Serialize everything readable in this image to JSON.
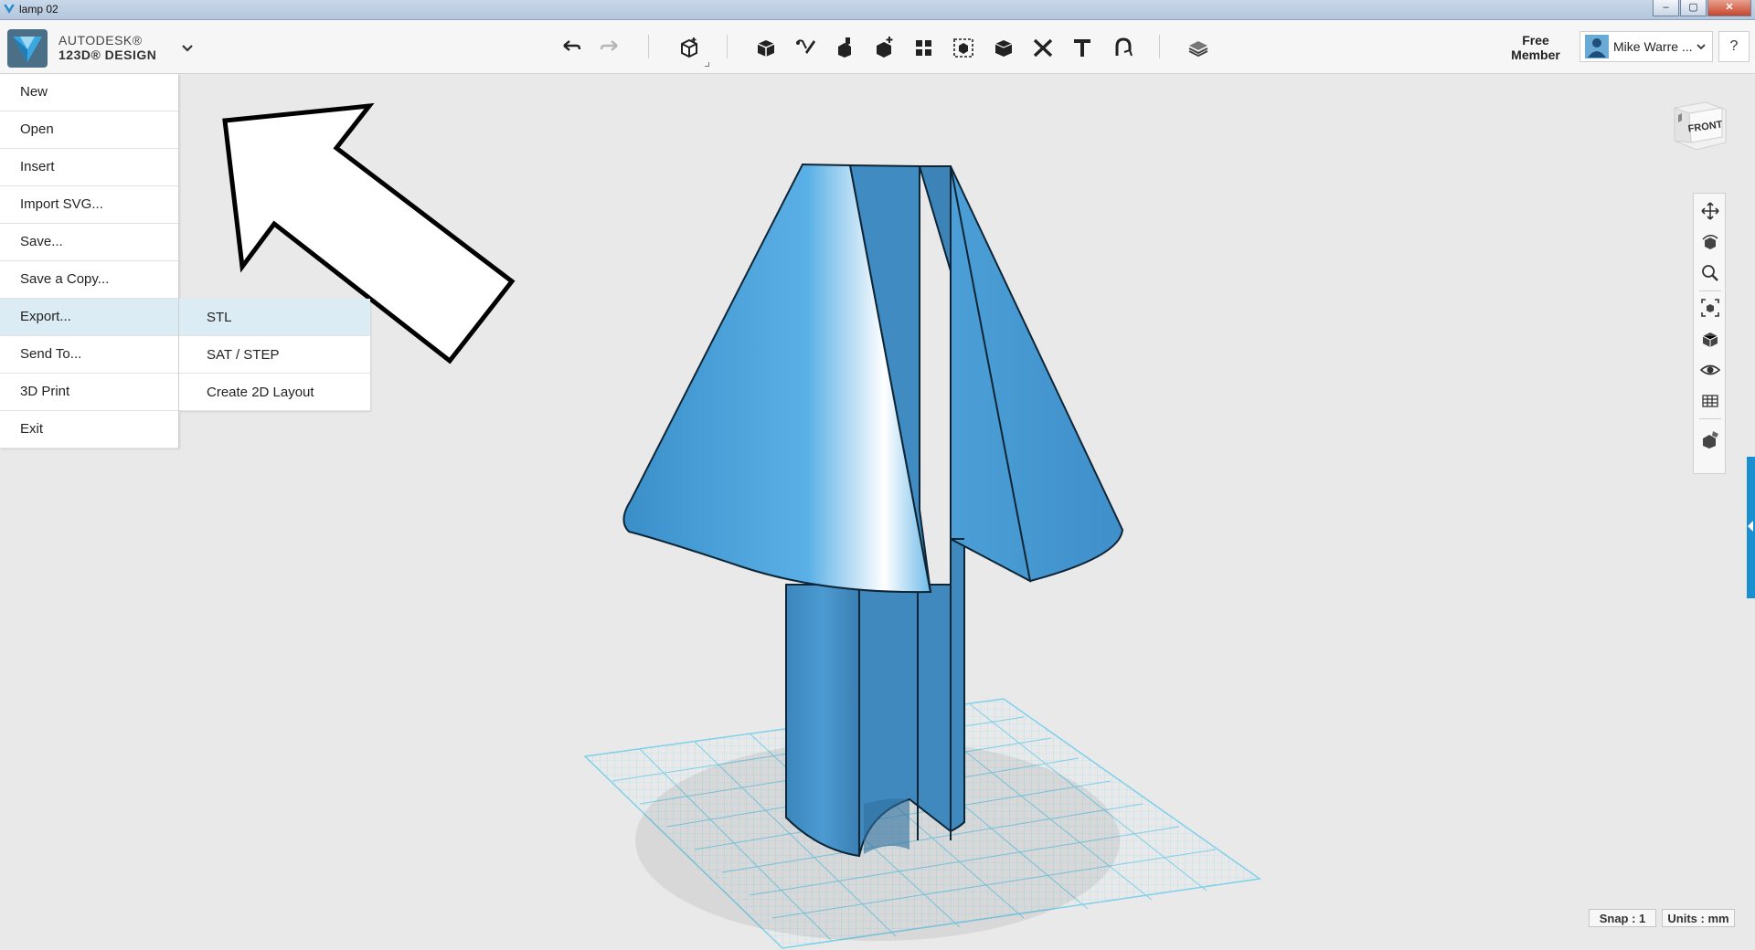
{
  "window": {
    "title": "lamp 02",
    "buttons": [
      "–",
      "▢",
      "✕"
    ]
  },
  "brand": {
    "line1": "AUTODESK®",
    "line2": "123D® DESIGN"
  },
  "toolbar": {
    "tools": [
      "undo-icon",
      "redo-icon",
      "primitives-icon",
      "box-icon",
      "sketch-icon",
      "construct-icon",
      "modify-icon",
      "pattern-icon",
      "group-icon",
      "combine-icon",
      "measure-icon",
      "text-icon",
      "snap-icon",
      "material-icon"
    ]
  },
  "account": {
    "membership": "Free Member",
    "user_name": "Mike Warre ...",
    "help": "?"
  },
  "file_menu": {
    "items": [
      "New",
      "Open",
      "Insert",
      "Import SVG...",
      "Save...",
      "Save a Copy...",
      "Export...",
      "Send To...",
      "3D Print",
      "Exit"
    ],
    "active": "Export..."
  },
  "export_submenu": {
    "items": [
      "STL",
      "SAT / STEP",
      "Create 2D Layout"
    ],
    "active": "STL"
  },
  "viewcube": {
    "face": "FRONT"
  },
  "nav": {
    "tools": [
      "pan-icon",
      "orbit-icon",
      "zoom-icon",
      "fit-icon",
      "view-material-icon",
      "visibility-icon",
      "grid-view-icon",
      "material-paint-icon"
    ]
  },
  "status": {
    "snap": "Snap : 1",
    "units": "Units : mm"
  },
  "colors": {
    "model": "#4aa3dc",
    "model_dark": "#3c84b7",
    "grid": "#8fd7ec",
    "menu_active": "#dcecf5",
    "side_tab": "#1a8fd0"
  }
}
